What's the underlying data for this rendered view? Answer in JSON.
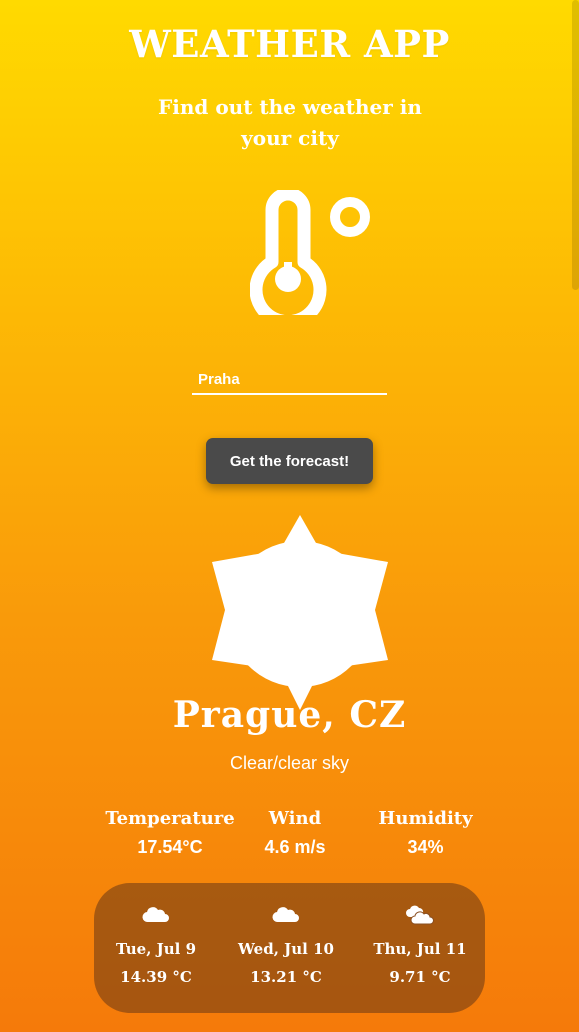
{
  "header": {
    "title": "WEATHER APP",
    "subtitle": "Find out the weather in your city"
  },
  "icons": {
    "hero": "thermometer-celsius-icon",
    "current_weather": "sun-icon",
    "forecast": [
      "cloud-icon",
      "cloud-icon",
      "clouds-icon"
    ]
  },
  "search": {
    "value": "Praha",
    "placeholder": ""
  },
  "button": {
    "label": "Get the forecast!"
  },
  "current": {
    "city": "Prague, CZ",
    "condition": "Clear/clear sky",
    "temperature_label": "Temperature",
    "temperature_value": "17.54°C",
    "wind_label": "Wind",
    "wind_value": "4.6 m/s",
    "humidity_label": "Humidity",
    "humidity_value": "34%"
  },
  "forecast": [
    {
      "date": "Tue, Jul 9",
      "temp": "14.39 °C"
    },
    {
      "date": "Wed, Jul 10",
      "temp": "13.21 °C"
    },
    {
      "date": "Thu, Jul 11",
      "temp": "9.71 °C"
    }
  ],
  "colors": {
    "gradient_top": "#FFDA00",
    "gradient_bottom": "#F57A0A",
    "button_bg": "#4a4a4a",
    "text": "#ffffff",
    "panel_bg": "#6E3A14"
  }
}
